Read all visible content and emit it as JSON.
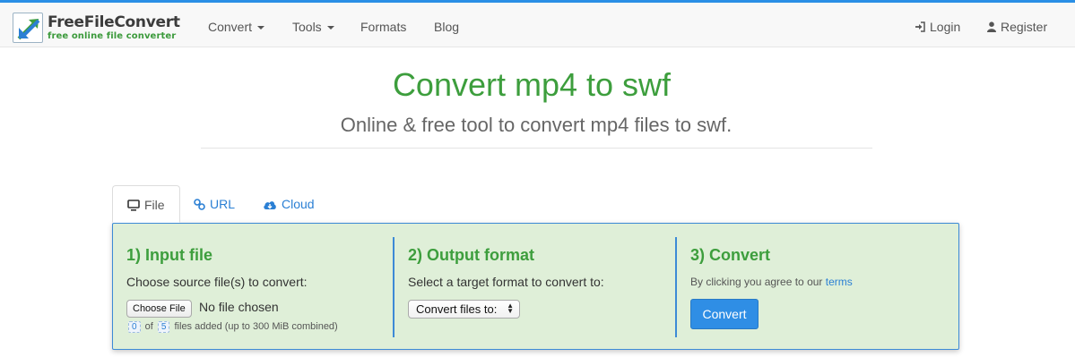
{
  "brand": {
    "name": "FreeFileConvert",
    "tagline": "free online file converter"
  },
  "nav": {
    "convert": "Convert",
    "tools": "Tools",
    "formats": "Formats",
    "blog": "Blog",
    "login": "Login",
    "register": "Register"
  },
  "header": {
    "title": "Convert mp4 to swf",
    "subtitle": "Online & free tool to convert mp4 files to swf."
  },
  "tabs": [
    {
      "label": "File",
      "icon": "monitor-icon",
      "active": true
    },
    {
      "label": "URL",
      "icon": "link-icon",
      "active": false
    },
    {
      "label": "Cloud",
      "icon": "cloud-icon",
      "active": false
    }
  ],
  "steps": {
    "input": {
      "title": "1) Input file",
      "text": "Choose source file(s) to convert:",
      "choose_button": "Choose File",
      "no_file": "No file chosen",
      "added_count": "0",
      "of": "of",
      "max_count": "5",
      "files_note": "files added (up to 300 MiB combined)"
    },
    "output": {
      "title": "2) Output format",
      "text": "Select a target format to convert to:",
      "select_value": "Convert files to:"
    },
    "convert": {
      "title": "3) Convert",
      "agree_text": "By clicking you agree to our",
      "terms_link": "terms",
      "button": "Convert"
    }
  },
  "colors": {
    "accent_blue": "#2f8ee5",
    "brand_green": "#3d9e3d",
    "panel_bg": "#dfefd8"
  }
}
